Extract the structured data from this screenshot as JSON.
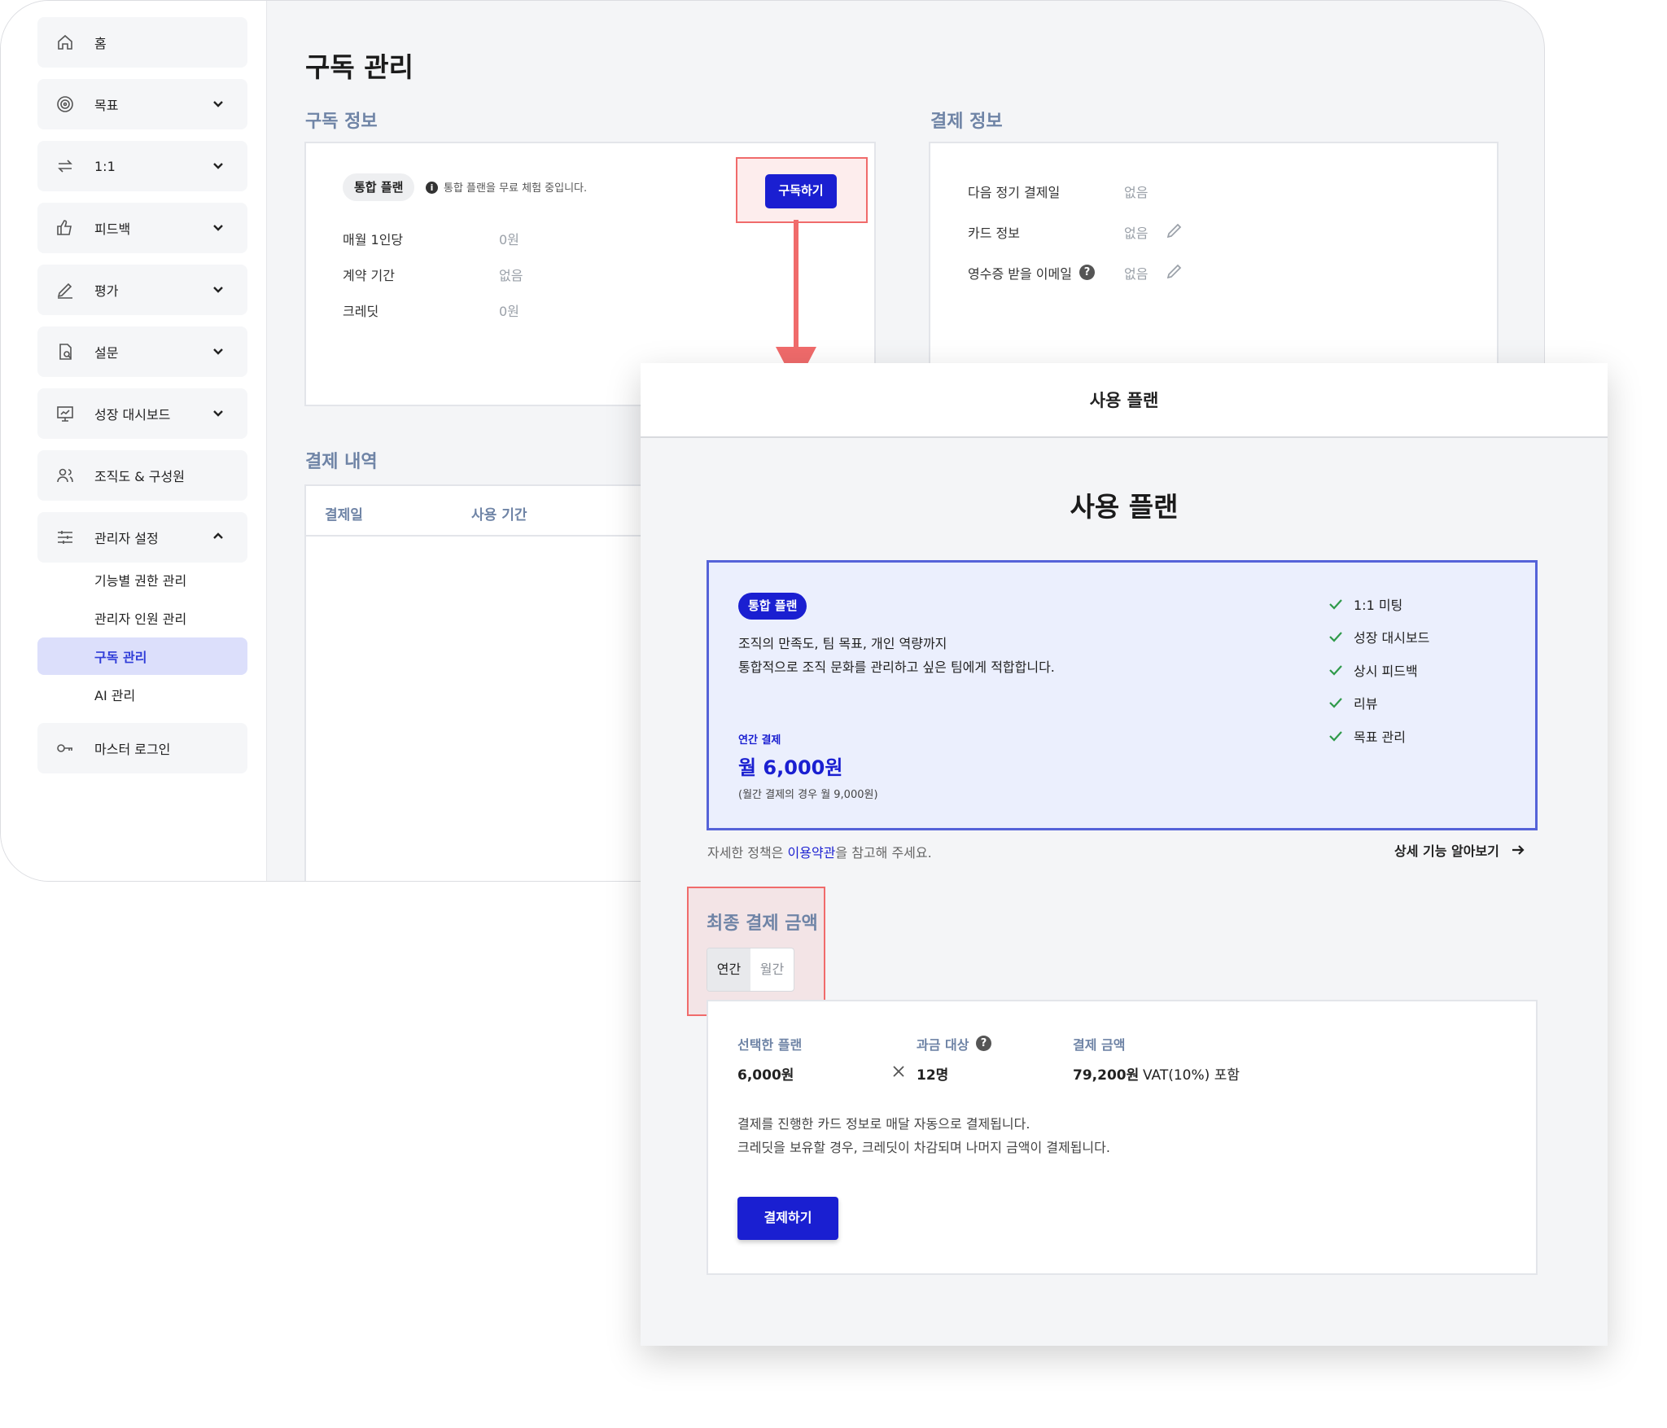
{
  "sidebar": {
    "items": [
      {
        "label": "홈",
        "icon": "home-icon"
      },
      {
        "label": "목표",
        "icon": "target-icon"
      },
      {
        "label": "1:1",
        "icon": "exchange-icon"
      },
      {
        "label": "피드백",
        "icon": "thumbs-up-icon"
      },
      {
        "label": "평가",
        "icon": "edit-icon"
      },
      {
        "label": "설문",
        "icon": "survey-icon"
      },
      {
        "label": "성장 대시보드",
        "icon": "dashboard-icon"
      },
      {
        "label": "조직도 & 구성원",
        "icon": "users-icon"
      },
      {
        "label": "관리자 설정",
        "icon": "sliders-icon"
      }
    ],
    "admin_sub": [
      "기능별 권한 관리",
      "관리자 인원 관리",
      "구독 관리",
      "AI 관리"
    ],
    "master_login": {
      "label": "마스터 로그인",
      "icon": "key-icon"
    }
  },
  "page": {
    "title": "구독 관리",
    "subscription_info": {
      "section_title": "구독 정보",
      "plan_badge": "통합 플랜",
      "trial_note": "통합 플랜을 무료 체험 중입니다.",
      "subscribe_button": "구독하기",
      "rows": [
        {
          "label": "매월 1인당",
          "value": "0원"
        },
        {
          "label": "계약 기간",
          "value": "없음"
        },
        {
          "label": "크레딧",
          "value": "0원"
        }
      ]
    },
    "payment_info": {
      "section_title": "결제 정보",
      "rows": [
        {
          "label": "다음 정기 결제일",
          "value": "없음"
        },
        {
          "label": "카드 정보",
          "value": "없음"
        },
        {
          "label": "영수증 받을 이메일",
          "value": "없음"
        }
      ]
    },
    "payment_history": {
      "section_title": "결제 내역",
      "columns": [
        "결제일",
        "사용 기간"
      ]
    }
  },
  "modal": {
    "header": "사용 플랜",
    "title": "사용 플랜",
    "plan": {
      "badge": "통합 플랜",
      "desc_line1": "조직의 만족도, 팀 목표, 개인 역량까지",
      "desc_line2": "통합적으로 조직 문화를 관리하고 싶은 팀에게 적합합니다.",
      "billing_label": "연간 결제",
      "price": "월 6,000원",
      "price_note": "(월간 결제의 경우 월 9,000원)",
      "features": [
        "1:1 미팅",
        "성장 대시보드",
        "상시 피드백",
        "리뷰",
        "목표 관리"
      ]
    },
    "policy": {
      "prefix": "자세한 정책은 ",
      "link": "이용약관",
      "suffix": "을 참고해 주세요."
    },
    "details_link": "상세 기능 알아보기",
    "final": {
      "title": "최종 결제 금액",
      "toggle": {
        "annual": "연간",
        "monthly": "월간"
      },
      "selected_plan_label": "선택한 플랜",
      "selected_plan_value": "6,000원",
      "billing_target_label": "과금 대상",
      "billing_target_value": "12명",
      "amount_label": "결제 금액",
      "amount_value": "79,200원",
      "vat_note": "VAT(10%) 포함",
      "note1": "결제를 진행한 카드 정보로 매달 자동으로 결제됩니다.",
      "note2": "크레딧을 보유할 경우, 크레딧이 차감되며 나머지 금액이 결제됩니다.",
      "pay_button": "결제하기"
    }
  },
  "colors": {
    "primary": "#1a1fd1",
    "highlight": "#f06b6b",
    "section_title": "#6f84a6",
    "active_nav_bg": "#dcdffb"
  }
}
